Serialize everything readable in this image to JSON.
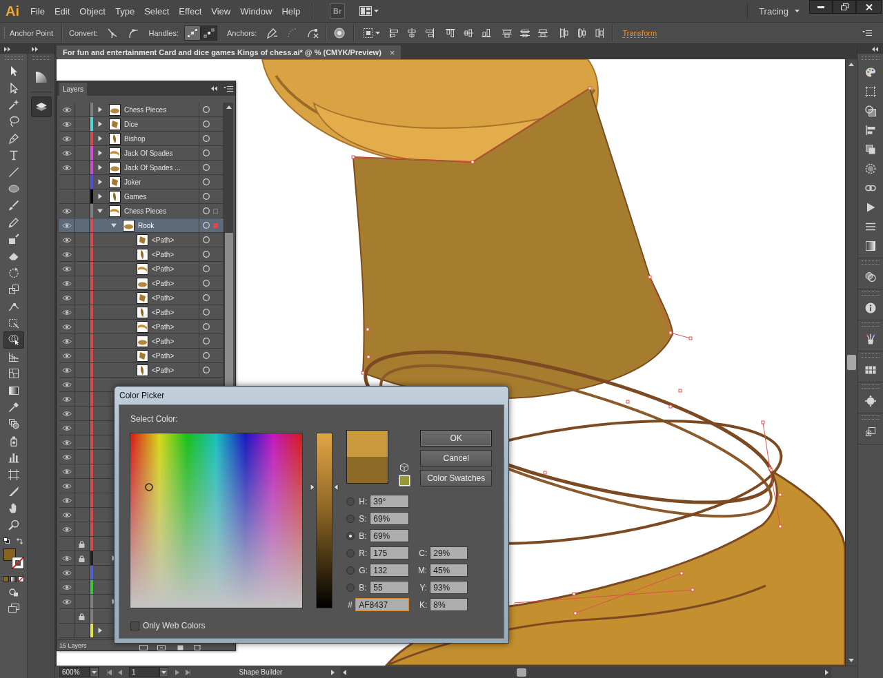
{
  "app": {
    "logo": "Ai",
    "bridge_button": "Br",
    "workspace": "Tracing"
  },
  "menu": [
    "File",
    "Edit",
    "Object",
    "Type",
    "Select",
    "Effect",
    "View",
    "Window",
    "Help"
  ],
  "control_bar": {
    "tool_name": "Anchor Point",
    "convert_label": "Convert:",
    "handles_label": "Handles:",
    "anchors_label": "Anchors:",
    "transform_link": "Transform",
    "handle_buttons": [
      {
        "kind": "show",
        "selected": true
      },
      {
        "kind": "hide",
        "selected": false
      }
    ],
    "anchor_buttons": [
      {
        "kind": "remove",
        "disabled": false
      },
      {
        "kind": "connect",
        "disabled": true
      },
      {
        "kind": "cut",
        "disabled": false
      }
    ]
  },
  "document_tab": {
    "title": "For fun and entertainment Card and dice games Kings of chess.ai* @ % (CMYK/Preview)",
    "close": "×"
  },
  "tools": [
    {
      "kind": "selection",
      "selected": false
    },
    {
      "kind": "direct",
      "selected": false
    },
    {
      "kind": "wand",
      "selected": false
    },
    {
      "kind": "lasso",
      "selected": false
    },
    {
      "kind": "pen",
      "selected": false
    },
    {
      "kind": "type",
      "selected": false
    },
    {
      "kind": "line",
      "selected": false
    },
    {
      "kind": "ellipse",
      "selected": false
    },
    {
      "kind": "brush",
      "selected": false
    },
    {
      "kind": "pencil",
      "selected": false
    },
    {
      "kind": "blob",
      "selected": false
    },
    {
      "kind": "eraser",
      "selected": false
    },
    {
      "kind": "rotate",
      "selected": false
    },
    {
      "kind": "scale",
      "selected": false
    },
    {
      "kind": "warp",
      "selected": false
    },
    {
      "kind": "transform",
      "selected": false
    },
    {
      "kind": "builder",
      "selected": true
    },
    {
      "kind": "perspective",
      "selected": false
    },
    {
      "kind": "mesh",
      "selected": false
    },
    {
      "kind": "gradient",
      "selected": false
    },
    {
      "kind": "eyedropper",
      "selected": false
    },
    {
      "kind": "blend",
      "selected": false
    },
    {
      "kind": "sprayer",
      "selected": false
    },
    {
      "kind": "graph",
      "selected": false
    },
    {
      "kind": "artboard",
      "selected": false
    },
    {
      "kind": "slice",
      "selected": false
    },
    {
      "kind": "hand",
      "selected": false
    },
    {
      "kind": "zoom",
      "selected": false
    }
  ],
  "fill_stroke": [
    {
      "kind": "fill",
      "color": "#86641f"
    },
    {
      "kind": "stroke_none"
    }
  ],
  "layers": {
    "title": "Layers",
    "count": "15 Layers",
    "rows": [
      {
        "kind": "layer",
        "name": "Chess Pieces",
        "visible": true,
        "locked": false,
        "color": "#7f7f7f",
        "expanded": false,
        "selected": false,
        "art_selected": false,
        "contains_selected_art": false
      },
      {
        "kind": "layer",
        "name": "Dice",
        "visible": true,
        "locked": false,
        "color": "#4fd8d8",
        "expanded": false,
        "selected": false,
        "art_selected": false,
        "contains_selected_art": false
      },
      {
        "kind": "layer",
        "name": "Bishop",
        "visible": true,
        "locked": false,
        "color": "#d94a4a",
        "expanded": false,
        "selected": false,
        "art_selected": false,
        "contains_selected_art": false
      },
      {
        "kind": "layer",
        "name": "Jack Of Spades",
        "visible": true,
        "locked": false,
        "color": "#d44fd4",
        "expanded": false,
        "selected": false,
        "art_selected": false,
        "contains_selected_art": false
      },
      {
        "kind": "layer",
        "name": "Jack Of Spades ...",
        "visible": true,
        "locked": false,
        "color": "#c84fc8",
        "expanded": false,
        "selected": false,
        "art_selected": false,
        "contains_selected_art": false
      },
      {
        "kind": "layer",
        "name": "Joker",
        "visible": false,
        "locked": false,
        "color": "#4f4fd4",
        "expanded": false,
        "selected": false,
        "art_selected": false,
        "contains_selected_art": false
      },
      {
        "kind": "layer",
        "name": "Games",
        "visible": false,
        "locked": false,
        "color": "#000000",
        "expanded": false,
        "selected": false,
        "art_selected": false,
        "contains_selected_art": false
      },
      {
        "kind": "layer",
        "name": "Chess Pieces",
        "visible": true,
        "locked": false,
        "color": "#7f7f7f",
        "expanded": true,
        "selected": false,
        "art_selected": false,
        "contains_selected_art": true,
        "children": [
          {
            "kind": "layer",
            "name": "Rook",
            "visible": true,
            "locked": false,
            "color": "#d94a4a",
            "expanded": true,
            "selected": true,
            "art_selected": true,
            "contains_selected_art": false,
            "children": [
              {
                "kind": "item",
                "name": "<Path>",
                "visible": true,
                "locked": false,
                "color": "#d94a4a",
                "selected": false,
                "art_selected": false,
                "contains_selected_art": false
              },
              {
                "kind": "item",
                "name": "<Path>",
                "visible": true,
                "locked": false,
                "color": "#d94a4a",
                "selected": false,
                "art_selected": false,
                "contains_selected_art": false
              },
              {
                "kind": "item",
                "name": "<Path>",
                "visible": true,
                "locked": false,
                "color": "#d94a4a",
                "selected": false,
                "art_selected": false,
                "contains_selected_art": false
              },
              {
                "kind": "item",
                "name": "<Path>",
                "visible": true,
                "locked": false,
                "color": "#d94a4a",
                "selected": false,
                "art_selected": false,
                "contains_selected_art": false
              },
              {
                "kind": "item",
                "name": "<Path>",
                "visible": true,
                "locked": false,
                "color": "#d94a4a",
                "selected": false,
                "art_selected": false,
                "contains_selected_art": false
              },
              {
                "kind": "item",
                "name": "<Path>",
                "visible": true,
                "locked": false,
                "color": "#d94a4a",
                "selected": false,
                "art_selected": false,
                "contains_selected_art": false
              },
              {
                "kind": "item",
                "name": "<Path>",
                "visible": true,
                "locked": false,
                "color": "#d94a4a",
                "selected": false,
                "art_selected": false,
                "contains_selected_art": false
              },
              {
                "kind": "item",
                "name": "<Path>",
                "visible": true,
                "locked": false,
                "color": "#d94a4a",
                "selected": false,
                "art_selected": false,
                "contains_selected_art": false
              },
              {
                "kind": "item",
                "name": "<Path>",
                "visible": true,
                "locked": false,
                "color": "#d94a4a",
                "selected": false,
                "art_selected": false,
                "contains_selected_art": false
              },
              {
                "kind": "item",
                "name": "<Path>",
                "visible": true,
                "locked": false,
                "color": "#d94a4a",
                "selected": false,
                "art_selected": false,
                "contains_selected_art": false
              },
              {
                "kind": "item",
                "visible": true,
                "locked": false,
                "color": "#d94a4a",
                "selected": false
              },
              {
                "kind": "item",
                "visible": true,
                "locked": false,
                "color": "#d94a4a",
                "selected": false
              },
              {
                "kind": "item",
                "visible": true,
                "locked": false,
                "color": "#d94a4a",
                "selected": false
              },
              {
                "kind": "item",
                "visible": true,
                "locked": false,
                "color": "#d94a4a",
                "selected": false
              },
              {
                "kind": "item",
                "visible": true,
                "locked": false,
                "color": "#d94a4a",
                "selected": false
              },
              {
                "kind": "item",
                "visible": true,
                "locked": false,
                "color": "#d94a4a",
                "selected": false
              },
              {
                "kind": "item",
                "visible": true,
                "locked": false,
                "color": "#d94a4a",
                "selected": false
              },
              {
                "kind": "item",
                "visible": true,
                "locked": false,
                "color": "#d94a4a",
                "selected": false
              },
              {
                "kind": "item",
                "visible": true,
                "locked": false,
                "color": "#d94a4a",
                "selected": false
              },
              {
                "kind": "item",
                "visible": true,
                "locked": false,
                "color": "#d94a4a",
                "selected": false
              },
              {
                "kind": "item",
                "visible": true,
                "locked": false,
                "color": "#d94a4a",
                "selected": false
              },
              {
                "kind": "item",
                "visible": false,
                "locked": true,
                "color": "#d94a4a",
                "selected": false
              }
            ]
          },
          {
            "kind": "layer",
            "visible": true,
            "locked": true,
            "color": "#1e1e1e",
            "expanded": false,
            "selected": false
          },
          {
            "kind": "item",
            "visible": true,
            "locked": false,
            "color": "#5060d0",
            "selected": false
          },
          {
            "kind": "item",
            "visible": true,
            "locked": false,
            "color": "#3fc43f",
            "selected": false
          },
          {
            "kind": "layer",
            "visible": true,
            "locked": false,
            "color": "#7f7f7f",
            "expanded": false,
            "selected": false
          },
          {
            "kind": "item",
            "visible": false,
            "locked": true,
            "color": "#7f7f7f",
            "selected": false
          }
        ]
      },
      {
        "kind": "layer",
        "visible": false,
        "locked": false,
        "color": "#e4e44a",
        "expanded": false,
        "selected": false
      }
    ]
  },
  "color_picker": {
    "title": "Color Picker",
    "select_label": "Select Color:",
    "buttons": [
      {
        "label": "OK",
        "kind": "default"
      },
      {
        "label": "Cancel",
        "kind": "normal"
      },
      {
        "label": "Color Swatches",
        "kind": "normal"
      }
    ],
    "swatches": [
      {
        "kind": "new",
        "color": "#c89a3d"
      },
      {
        "kind": "original",
        "color": "#8c6a25"
      },
      {
        "kind": "web_safe",
        "color": "#999933"
      }
    ],
    "slider": {
      "level": 0.69
    },
    "fields": [
      {
        "label": "H:",
        "value": "39°",
        "selected": false
      },
      {
        "label": "S:",
        "value": "69%",
        "selected": false
      },
      {
        "label": "B:",
        "value": "69%",
        "selected": true
      },
      {
        "label": "R:",
        "value": "175",
        "selected": false
      },
      {
        "label": "G:",
        "value": "132",
        "selected": false
      },
      {
        "label": "B:",
        "value": "55",
        "selected": false
      }
    ],
    "cmyk": [
      {
        "label": "C:",
        "value": "29%"
      },
      {
        "label": "M:",
        "value": "45%"
      },
      {
        "label": "Y:",
        "value": "93%"
      },
      {
        "label": "K:",
        "value": "8%"
      }
    ],
    "hex": {
      "label": "#",
      "value": "AF8437"
    },
    "web_colors": {
      "label": "Only Web Colors",
      "checked": false
    }
  },
  "status_bar": {
    "zoom": "600%",
    "artboard": "1",
    "tool": "Shape Builder"
  }
}
